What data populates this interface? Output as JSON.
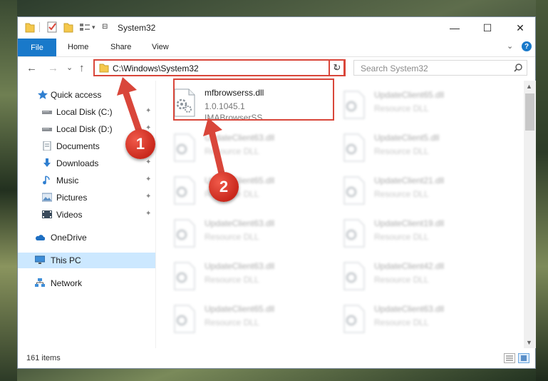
{
  "window": {
    "title": "System32",
    "controls": {
      "minimize": "—",
      "maximize": "☐",
      "close": "✕"
    }
  },
  "ribbon": {
    "tabs": [
      "File",
      "Home",
      "Share",
      "View"
    ],
    "help": "?"
  },
  "navigation": {
    "back": "←",
    "forward": "→",
    "recent": "⌄",
    "up": "↑",
    "address": "C:\\Windows\\System32",
    "address_dropdown": "⌄",
    "refresh": "↻",
    "search_placeholder": "Search System32"
  },
  "sidebar": {
    "items": [
      {
        "label": "Quick access",
        "icon": "star-icon",
        "pinned": false
      },
      {
        "label": "Local Disk (C:)",
        "icon": "drive-icon",
        "pinned": true
      },
      {
        "label": "Local Disk (D:)",
        "icon": "drive-icon",
        "pinned": true
      },
      {
        "label": "Documents",
        "icon": "documents-icon",
        "pinned": true
      },
      {
        "label": "Downloads",
        "icon": "download-icon",
        "pinned": true
      },
      {
        "label": "Music",
        "icon": "music-icon",
        "pinned": true
      },
      {
        "label": "Pictures",
        "icon": "pictures-icon",
        "pinned": true
      },
      {
        "label": "Videos",
        "icon": "videos-icon",
        "pinned": true
      },
      {
        "label": "OneDrive",
        "icon": "cloud-icon",
        "pinned": false
      },
      {
        "label": "This PC",
        "icon": "computer-icon",
        "pinned": false,
        "selected": true
      },
      {
        "label": "Network",
        "icon": "network-icon",
        "pinned": false
      }
    ],
    "pin_glyph": "📌"
  },
  "files": {
    "left_column": [
      {
        "name": "mfbrowserss.dll",
        "line2": "1.0.1045.1",
        "line3": "IMABrowserSS",
        "highlighted": true
      },
      {
        "name": "UpdateClient63.dll",
        "line2": "Resource DLL"
      },
      {
        "name": "UpdateClient65.dll",
        "line2": "Resource DLL"
      },
      {
        "name": "UpdateClient63.dll",
        "line2": "Resource DLL"
      },
      {
        "name": "UpdateClient63.dll",
        "line2": "Resource DLL"
      },
      {
        "name": "UpdateClient65.dll",
        "line2": "Resource DLL"
      }
    ],
    "right_column": [
      {
        "name": "UpdateClient65.dll",
        "line2": "Resource DLL"
      },
      {
        "name": "UpdateClient5.dll",
        "line2": "Resource DLL"
      },
      {
        "name": "UpdateClient21.dll",
        "line2": "Resource DLL"
      },
      {
        "name": "UpdateClient19.dll",
        "line2": "Resource DLL"
      },
      {
        "name": "UpdateClient42.dll",
        "line2": "Resource DLL"
      },
      {
        "name": "UpdateClient63.dll",
        "line2": "Resource DLL"
      }
    ]
  },
  "status": {
    "item_count": "161 items"
  },
  "annotations": {
    "step1": "1",
    "step2": "2",
    "color": "#d9463a"
  }
}
